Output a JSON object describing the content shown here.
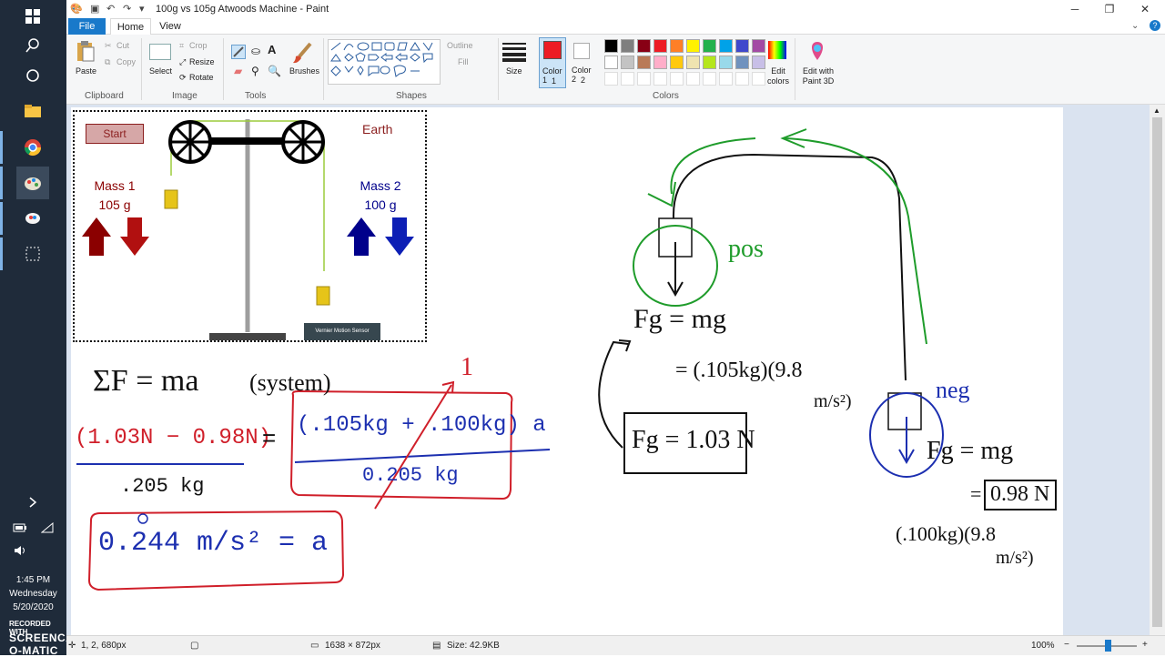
{
  "window": {
    "title": "100g vs 105g Atwoods Machine - Paint",
    "minimize": "─",
    "maximize": "❐",
    "close": "✕"
  },
  "tabs": {
    "file": "File",
    "home": "Home",
    "view": "View"
  },
  "ribbon": {
    "clipboard": {
      "label": "Clipboard",
      "paste": "Paste",
      "cut": "Cut",
      "copy": "Copy"
    },
    "image": {
      "label": "Image",
      "select": "Select",
      "crop": "Crop",
      "resize": "Resize",
      "rotate": "Rotate"
    },
    "tools": {
      "label": "Tools"
    },
    "brushes": "Brushes",
    "shapes": {
      "label": "Shapes",
      "outline": "Outline",
      "fill": "Fill"
    },
    "size": "Size",
    "color1": "Color 1",
    "color1_num": "1",
    "color2": "Color 2",
    "color2_num": "2",
    "colors_label": "Colors",
    "edit_colors": "Edit colors",
    "edit_paint3d": "Edit with Paint 3D",
    "palette_row1": [
      "#000000",
      "#7f7f7f",
      "#880015",
      "#ed1c24",
      "#ff7f27",
      "#fff200",
      "#22b14c",
      "#00a2e8",
      "#3f48cc",
      "#a349a4"
    ],
    "palette_row2": [
      "#ffffff",
      "#c3c3c3",
      "#b97a57",
      "#ffaec9",
      "#ffc90e",
      "#efe4b0",
      "#b5e61d",
      "#99d9ea",
      "#7092be",
      "#c8bfe7"
    ],
    "color1_value": "#ed1c24",
    "color2_value": "#ffffff"
  },
  "sim": {
    "start": "Start",
    "earth": "Earth",
    "mass1_title": "Mass 1",
    "mass1_value": "105 g",
    "mass2_title": "Mass 2",
    "mass2_value": "100 g",
    "sensor": "Vernier Motion Sensor"
  },
  "notes": {
    "sum_f": "ΣF = ma",
    "system": "(system)",
    "num": "(1.03N − 0.98N)",
    "eq": "=",
    "den": ".205 kg",
    "rhs_num": "(.105kg + .100kg) a",
    "rhs_den": "0.205 kg",
    "one": "1",
    "result": "0.244 m/s² = a",
    "fg1": "Fg = mg",
    "fg1_calc_a": "= (.105kg)(9.8",
    "fg1_calc_b": "m/s²)",
    "fg1_result": "Fg = 1.03 N",
    "pos": "pos",
    "neg": "neg",
    "fg2": "Fg = mg",
    "fg2_result": "0.98 N",
    "fg2_eq": "=",
    "fg2_calc_a": "(.100kg)(9.8",
    "fg2_calc_b": "m/s²)"
  },
  "statusbar": {
    "cursor": "1, 2, 680px",
    "dimensions": "1638 × 872px",
    "size": "Size: 42.9KB",
    "zoom": "100%"
  },
  "taskbar": {
    "time": "1:45 PM",
    "day": "Wednesday",
    "date": "5/20/2020",
    "rec_label": "RECORDED WITH",
    "rec_brand": "SCREENCAST-O-MATIC"
  }
}
